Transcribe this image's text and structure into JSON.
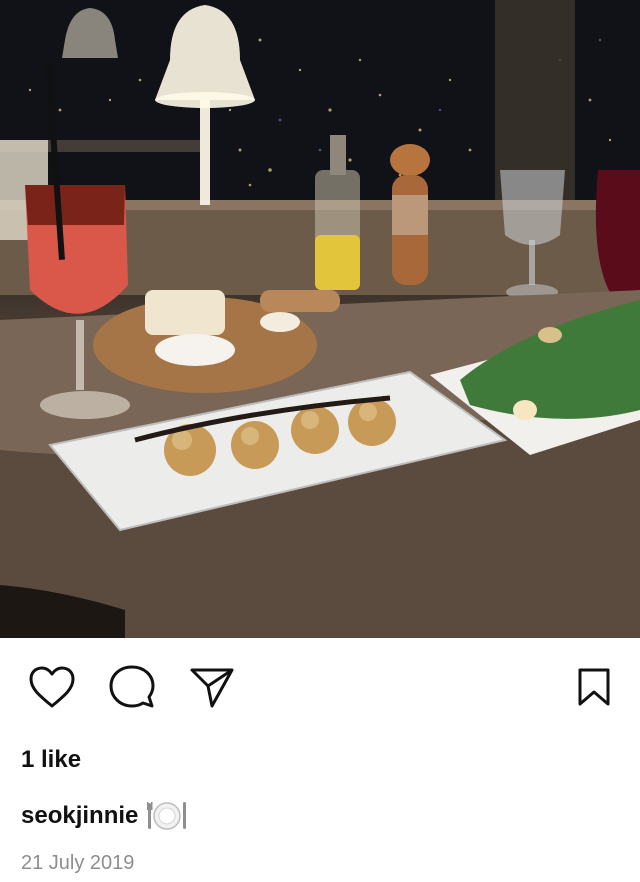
{
  "post": {
    "image_alt": "Dinner table by a window overlooking a city at night with a red drink, bread board, croquettes on a white plate and a salad",
    "likes_text": "1 like",
    "username": "seokjinnie",
    "caption_emoji": "plate-with-cutlery",
    "date": "21 July 2019"
  },
  "actions": {
    "like_icon": "heart-icon",
    "comment_icon": "comment-bubble-icon",
    "share_icon": "paper-plane-icon",
    "save_icon": "bookmark-icon"
  },
  "colors": {
    "text": "#111111",
    "muted": "#8e8e8e",
    "background": "#ffffff"
  }
}
